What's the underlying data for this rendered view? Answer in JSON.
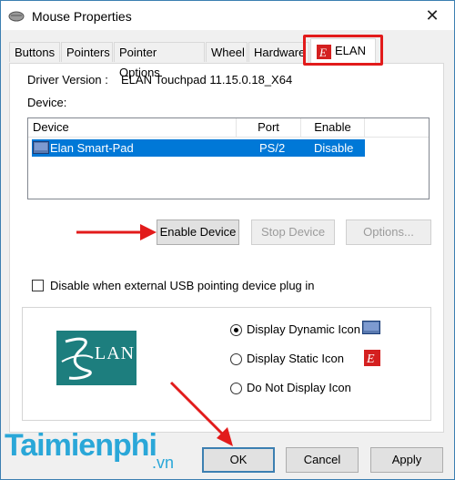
{
  "window": {
    "title": "Mouse Properties",
    "close_symbol": "✕"
  },
  "tabs": [
    "Buttons",
    "Pointers",
    "Pointer Options",
    "Wheel",
    "Hardware",
    "ELAN"
  ],
  "active_tab": "ELAN",
  "driver": {
    "label": "Driver Version :",
    "value": "ELAN Touchpad 11.15.0.18_X64"
  },
  "device_label": "Device:",
  "device_list": {
    "columns": [
      "Device",
      "Port",
      "Enable"
    ],
    "rows": [
      {
        "device": "Elan Smart-Pad",
        "port": "PS/2",
        "enable": "Disable"
      }
    ]
  },
  "buttons": {
    "enable": "Enable Device",
    "stop": "Stop Device",
    "options": "Options..."
  },
  "usb_checkbox": {
    "label": "Disable when external USB pointing device plug in",
    "checked": false
  },
  "logo_text": "LAN",
  "icon_options": [
    {
      "label": "Display Dynamic Icon",
      "selected": true
    },
    {
      "label": "Display Static Icon",
      "selected": false
    },
    {
      "label": "Do Not Display Icon",
      "selected": false
    }
  ],
  "footer": {
    "ok": "OK",
    "cancel": "Cancel",
    "apply": "Apply"
  },
  "watermark": {
    "main": "Taimienphi",
    "suffix": ".vn"
  },
  "colors": {
    "selection": "#0078d7",
    "annotation_red": "#e21b1b",
    "logo_teal": "#1d7e7e",
    "elan_red": "#d42020"
  }
}
